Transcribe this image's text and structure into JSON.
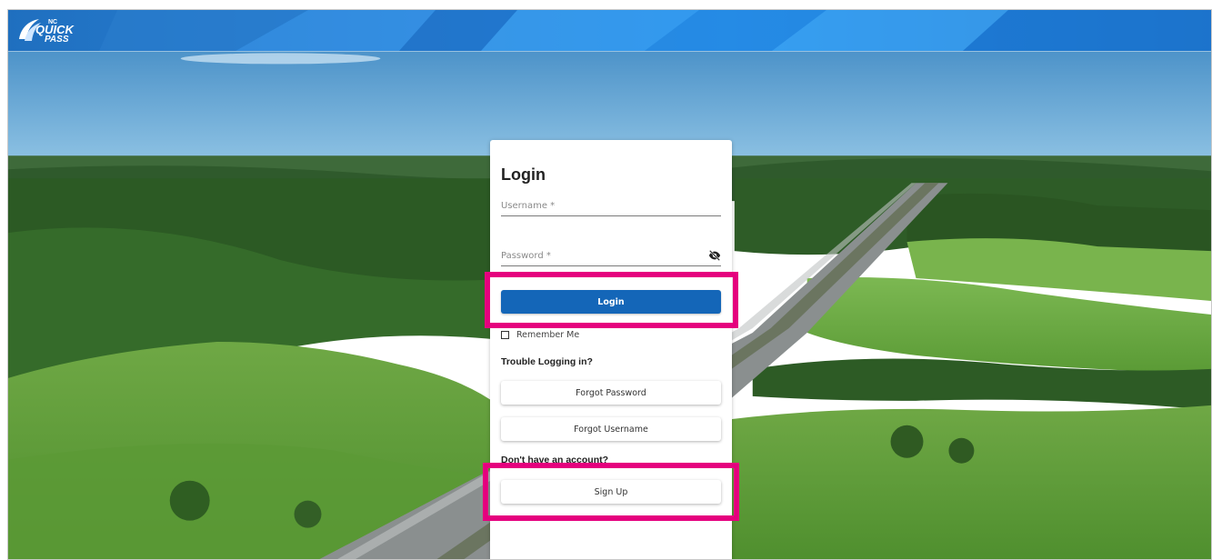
{
  "colors": {
    "header_blue": "#1f6fbf",
    "primary_button": "#1466b8",
    "highlight": "#e5007e"
  },
  "header": {
    "logo_small": "NC",
    "logo_main": "QUICK",
    "logo_sub": "PASS"
  },
  "login": {
    "title": "Login",
    "username_placeholder": "Username *",
    "password_placeholder": "Password *",
    "password_toggle_icon": "eye-off-icon",
    "login_button": "Login",
    "remember_me": "Remember Me",
    "trouble_heading": "Trouble Logging in?",
    "forgot_password": "Forgot Password",
    "forgot_username": "Forgot Username",
    "no_account_heading": "Don't have an account?",
    "sign_up": "Sign Up"
  }
}
